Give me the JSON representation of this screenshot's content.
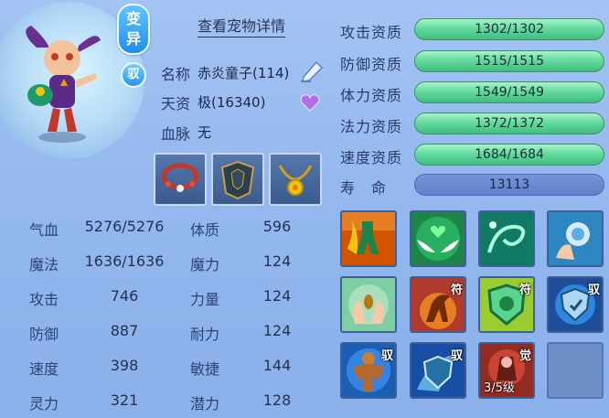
{
  "header": {
    "badge_bianyi_top": "变",
    "badge_bianyi_bottom": "异",
    "badge_yu": "驭",
    "detail_link": "查看宠物详情"
  },
  "info": {
    "name_label": "名称",
    "name_value": "赤炎童子(114)",
    "aptitude_label": "天资",
    "aptitude_value": "极(16340)",
    "bloodline_label": "血脉",
    "bloodline_value": "无"
  },
  "equipment": [
    {
      "name": "collar-red-beads"
    },
    {
      "name": "armor-dark-spiked"
    },
    {
      "name": "necklace-gold-medallion"
    }
  ],
  "attributes": [
    {
      "label": "气血",
      "value": "5276/5276",
      "label2": "体质",
      "value2": "596"
    },
    {
      "label": "魔法",
      "value": "1636/1636",
      "label2": "魔力",
      "value2": "124"
    },
    {
      "label": "攻击",
      "value": "746",
      "label2": "力量",
      "value2": "124"
    },
    {
      "label": "防御",
      "value": "887",
      "label2": "耐力",
      "value2": "124"
    },
    {
      "label": "速度",
      "value": "398",
      "label2": "敏捷",
      "value2": "144"
    },
    {
      "label": "灵力",
      "value": "321",
      "label2": "潜力",
      "value2": "128"
    }
  ],
  "aptitudes": [
    {
      "label": "攻击资质",
      "value": "1302/1302",
      "fill": 1.0
    },
    {
      "label": "防御资质",
      "value": "1515/1515",
      "fill": 1.0
    },
    {
      "label": "体力资质",
      "value": "1549/1549",
      "fill": 1.0
    },
    {
      "label": "法力资质",
      "value": "1372/1372",
      "fill": 1.0
    },
    {
      "label": "速度资质",
      "value": "1684/1684",
      "fill": 1.0
    }
  ],
  "lifespan": {
    "label": "寿　命",
    "value": "13113"
  },
  "skills": [
    {
      "name": "skill-fire-figure",
      "tag": ""
    },
    {
      "name": "skill-green-heart-wings",
      "tag": ""
    },
    {
      "name": "skill-green-swirl",
      "tag": ""
    },
    {
      "name": "skill-hand-orb",
      "tag": ""
    },
    {
      "name": "skill-hand-seed",
      "tag": ""
    },
    {
      "name": "skill-horse-charm",
      "tag": "符"
    },
    {
      "name": "skill-shield-charm",
      "tag": "符"
    },
    {
      "name": "skill-blue-shield",
      "tag": "驭"
    },
    {
      "name": "skill-muscle-body",
      "tag": "驭"
    },
    {
      "name": "skill-blue-shield-2",
      "tag": "驭"
    },
    {
      "name": "skill-awaken",
      "tag": "觉",
      "level": "3/5级"
    },
    {
      "name": "skill-empty",
      "tag": ""
    }
  ],
  "colors": {
    "bar_green": "#64db9e",
    "bar_life": "#6a8bd4",
    "background": "#94b8ef"
  }
}
